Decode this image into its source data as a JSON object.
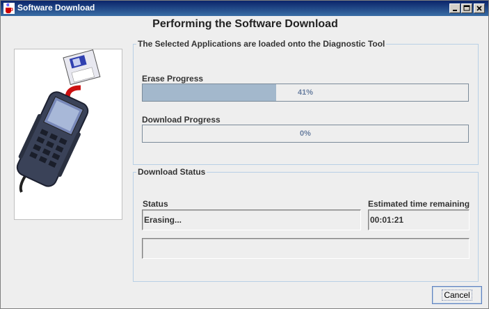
{
  "window": {
    "title": "Software Download"
  },
  "heading": "Performing the Software Download",
  "applications_group": {
    "title": "The Selected Applications are loaded onto the Diagnostic Tool",
    "erase": {
      "label": "Erase Progress",
      "percent_text": "41%",
      "fraction": 0.41
    },
    "download": {
      "label": "Download Progress",
      "percent_text": "0%",
      "fraction": 0.0
    }
  },
  "status_group": {
    "title": "Download Status",
    "status_label": "Status",
    "status_value": "Erasing...",
    "time_label": "Estimated time remaining",
    "time_value": "00:01:21",
    "message_value": ""
  },
  "buttons": {
    "cancel": "Cancel"
  },
  "icons": {
    "app": "java-cup-icon",
    "minimize": "minimize-icon",
    "maximize": "maximize-icon",
    "close": "close-icon",
    "illustration": "diagnostic-tool-floppy-illustration"
  },
  "colors": {
    "titlebar": "#0a246a",
    "progress_fill": "#a3b8cc",
    "group_border": "#b8cfe5"
  }
}
